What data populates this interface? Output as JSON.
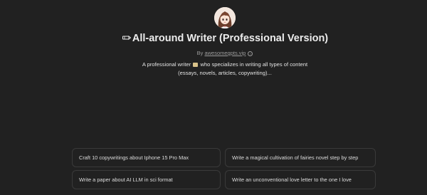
{
  "gpt": {
    "avatar_icon": "anime-girl-avatar-icon",
    "title_icon": "pencil-icon",
    "title": "All-around Writer (Professional Version)",
    "byline_prefix": "By",
    "author": "awesomegpts.vip",
    "info_icon": "info-icon",
    "description_line1_a": "A professional writer",
    "description_icon": "scroll-icon",
    "description_line1_b": "who specializes in writing all types of content",
    "description_line2": "(essays, novels, articles, copywriting)..."
  },
  "starters": [
    {
      "label": "Craft 10 copywritings about Iphone 15 Pro Max"
    },
    {
      "label": "Write a magical cultivation of fairies novel step by step"
    },
    {
      "label": "Write a paper about AI LLM in sci format"
    },
    {
      "label": "Write an unconventional love letter to the one I love"
    }
  ],
  "colors": {
    "background": "#212121",
    "text": "#ececec",
    "muted": "#9b9b9b",
    "border": "#3a3a3a"
  }
}
